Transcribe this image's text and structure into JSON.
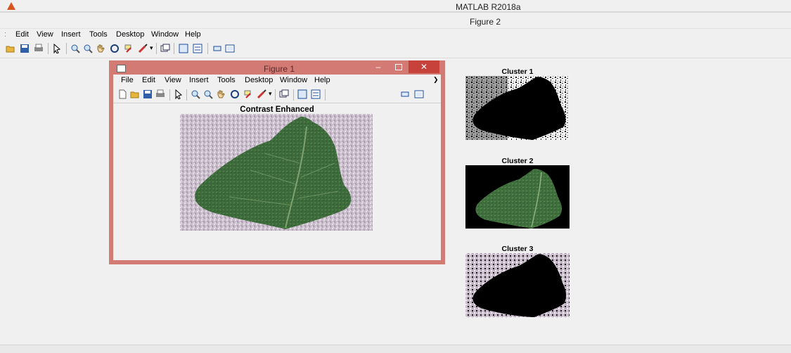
{
  "window": {
    "title": "MATLAB R2018a",
    "figure_title": "Figure 2"
  },
  "main_menu": [
    "Edit",
    "View",
    "Insert",
    "Tools",
    "Desktop",
    "Window",
    "Help"
  ],
  "figure1": {
    "title": "Figure 1",
    "menu": [
      "File",
      "Edit",
      "View",
      "Insert",
      "Tools",
      "Desktop",
      "Window",
      "Help"
    ],
    "axes_title": "Contrast Enhanced",
    "min_glyph": "–",
    "close_glyph": "✕",
    "overflow_glyph": "❯"
  },
  "clusters": [
    {
      "title": "Cluster 1"
    },
    {
      "title": "Cluster 2"
    },
    {
      "title": "Cluster 3"
    }
  ],
  "toolbar_icons": [
    "new-file-icon",
    "open-folder-icon",
    "save-icon",
    "print-icon",
    "pointer-icon",
    "zoom-in-icon",
    "zoom-out-icon",
    "pan-icon",
    "rotate-3d-icon",
    "data-cursor-icon",
    "brush-icon",
    "link-plot-icon",
    "colorbar-icon",
    "legend-icon",
    "hide-plot-tools-icon",
    "show-plot-tools-icon"
  ],
  "colors": {
    "figure1_frame": "#d37a74",
    "close_button": "#c7423a",
    "leaf_green": "#3f6f3c",
    "background_pink": "#c8b8c6"
  }
}
